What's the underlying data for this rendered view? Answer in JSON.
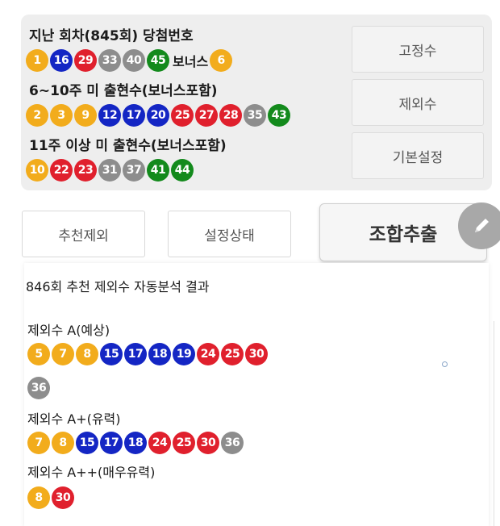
{
  "last_draw": {
    "title": "지난 회차(845회) 당첨번호",
    "numbers": [
      {
        "n": "1",
        "c": "y"
      },
      {
        "n": "16",
        "c": "b"
      },
      {
        "n": "29",
        "c": "r"
      },
      {
        "n": "33",
        "c": "g"
      },
      {
        "n": "40",
        "c": "g"
      },
      {
        "n": "45",
        "c": "gr"
      }
    ],
    "bonus_label": "보너스",
    "bonus": {
      "n": "6",
      "c": "y"
    }
  },
  "not_drawn_6_10": {
    "title": "6~10주 미 출현수(보너스포함)",
    "numbers": [
      {
        "n": "2",
        "c": "y"
      },
      {
        "n": "3",
        "c": "y"
      },
      {
        "n": "9",
        "c": "y"
      },
      {
        "n": "12",
        "c": "b"
      },
      {
        "n": "17",
        "c": "b"
      },
      {
        "n": "20",
        "c": "b"
      },
      {
        "n": "25",
        "c": "r"
      },
      {
        "n": "27",
        "c": "r"
      },
      {
        "n": "28",
        "c": "r"
      },
      {
        "n": "35",
        "c": "g"
      },
      {
        "n": "43",
        "c": "gr"
      }
    ]
  },
  "not_drawn_11plus": {
    "title": "11주 이상 미 출현수(보너스포함)",
    "numbers": [
      {
        "n": "10",
        "c": "y"
      },
      {
        "n": "22",
        "c": "r"
      },
      {
        "n": "23",
        "c": "r"
      },
      {
        "n": "31",
        "c": "g"
      },
      {
        "n": "37",
        "c": "g"
      },
      {
        "n": "41",
        "c": "gr"
      },
      {
        "n": "44",
        "c": "gr"
      }
    ]
  },
  "side_buttons": {
    "fixed": "고정수",
    "exclude": "제외수",
    "default": "기본설정"
  },
  "action_buttons": {
    "recommend_exclude": "추천제외",
    "settings_status": "설정상태",
    "combine": "조합추출"
  },
  "result": {
    "title": "846회 추천 제외수 자동분석 결과",
    "groups": [
      {
        "label": "제외수 A(예상)",
        "numbers": [
          {
            "n": "5",
            "c": "y"
          },
          {
            "n": "7",
            "c": "y"
          },
          {
            "n": "8",
            "c": "y"
          },
          {
            "n": "15",
            "c": "b"
          },
          {
            "n": "17",
            "c": "b"
          },
          {
            "n": "18",
            "c": "b"
          },
          {
            "n": "19",
            "c": "b"
          },
          {
            "n": "24",
            "c": "r"
          },
          {
            "n": "25",
            "c": "r"
          },
          {
            "n": "30",
            "c": "r"
          },
          {
            "n": "36",
            "c": "g"
          }
        ]
      },
      {
        "label": "제외수 A+(유력)",
        "numbers": [
          {
            "n": "7",
            "c": "y"
          },
          {
            "n": "8",
            "c": "y"
          },
          {
            "n": "15",
            "c": "b"
          },
          {
            "n": "17",
            "c": "b"
          },
          {
            "n": "18",
            "c": "b"
          },
          {
            "n": "24",
            "c": "r"
          },
          {
            "n": "25",
            "c": "r"
          },
          {
            "n": "30",
            "c": "r"
          },
          {
            "n": "36",
            "c": "g"
          }
        ]
      },
      {
        "label": "제외수 A++(매우유력)",
        "numbers": [
          {
            "n": "8",
            "c": "y"
          },
          {
            "n": "30",
            "c": "r"
          }
        ]
      }
    ]
  },
  "icons": {
    "edit_fab": "pencil-icon"
  },
  "colors": {
    "yellow": "#f2ac1c",
    "blue": "#1426c4",
    "red": "#e0202d",
    "gray": "#8d8d8d",
    "green": "#138a1c"
  }
}
